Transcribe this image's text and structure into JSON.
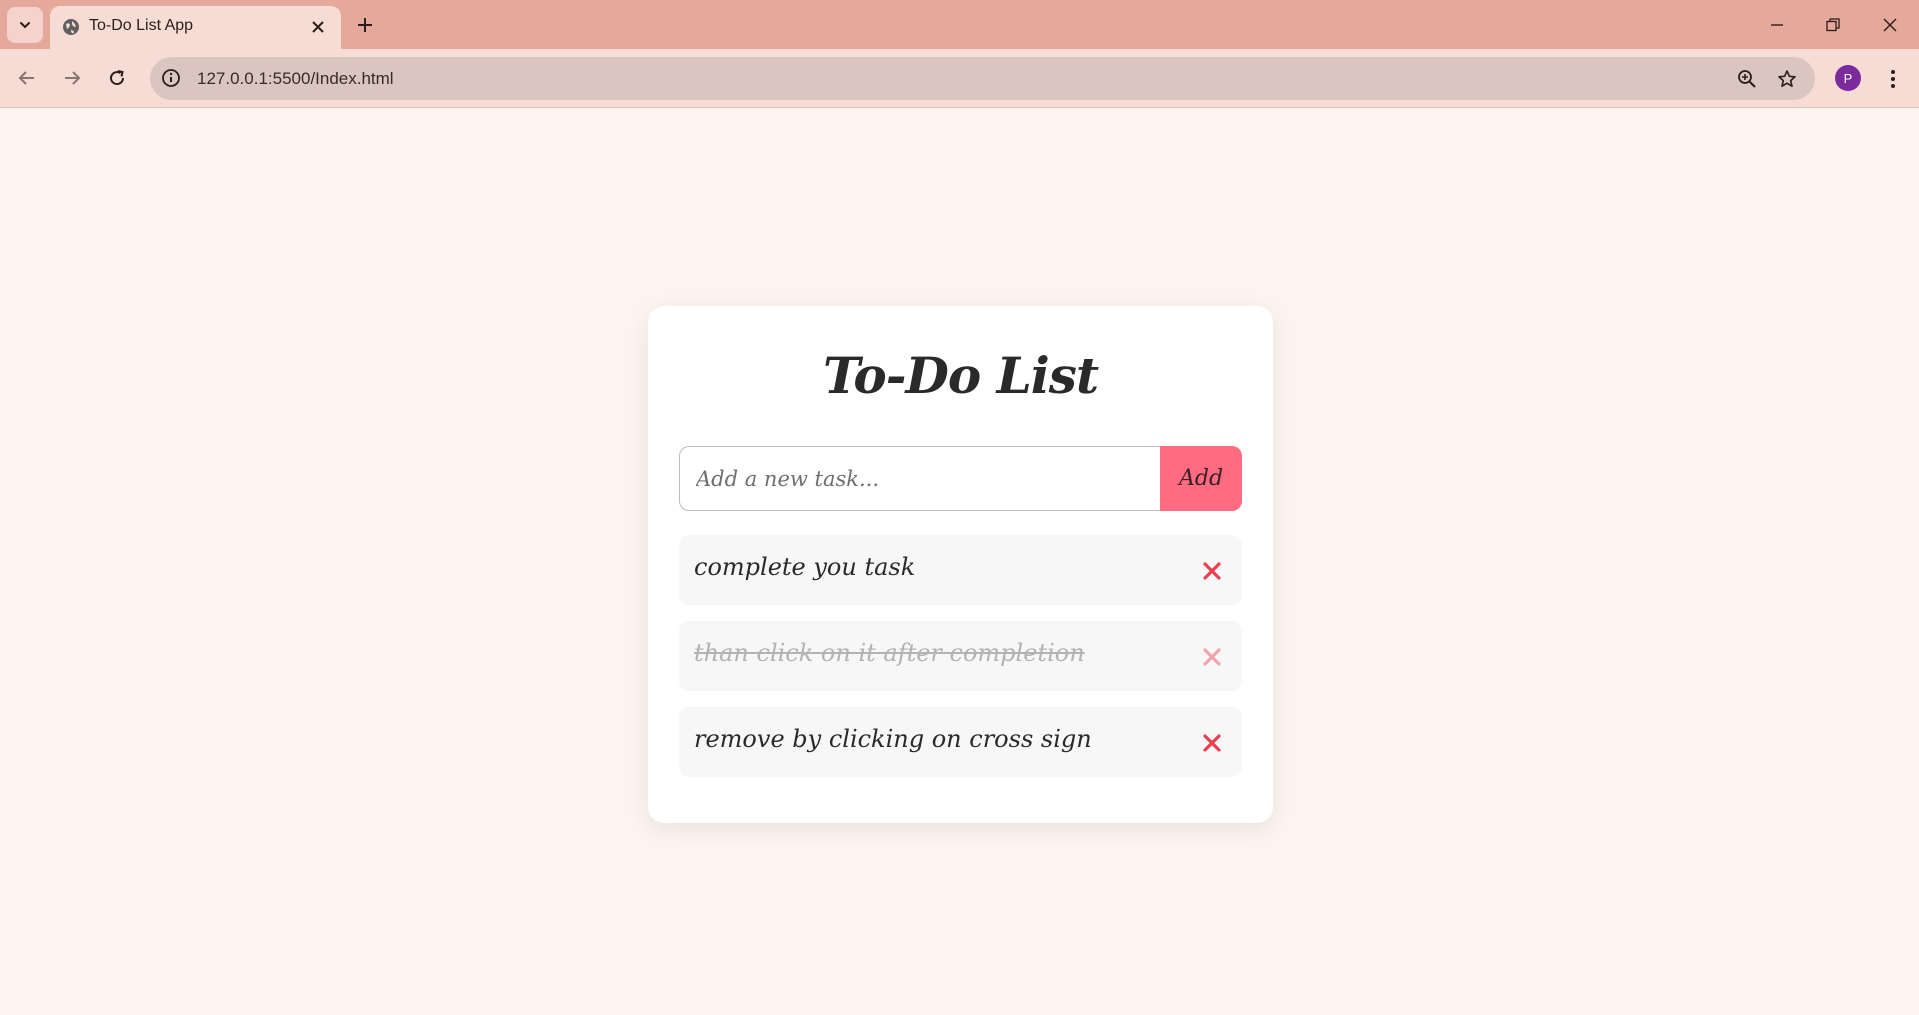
{
  "browser": {
    "tab_title": "To-Do List App",
    "url": "127.0.0.1:5500/Index.html",
    "profile_initial": "P",
    "colors": {
      "tabbar": "#e4a99a",
      "toolbar": "#f7dcd5",
      "omnibox": "#d9c6c0",
      "avatar": "#7b2a9c"
    }
  },
  "app": {
    "title": "To-Do List",
    "input_placeholder": "Add a new task...",
    "input_value": "",
    "add_label": "Add",
    "accent_color": "#ff6b81",
    "delete_color": "#e8404f",
    "tasks": [
      {
        "text": "complete you task",
        "completed": false
      },
      {
        "text": "than click on it after completion",
        "completed": true
      },
      {
        "text": "remove by clicking on cross sign",
        "completed": false
      }
    ]
  }
}
